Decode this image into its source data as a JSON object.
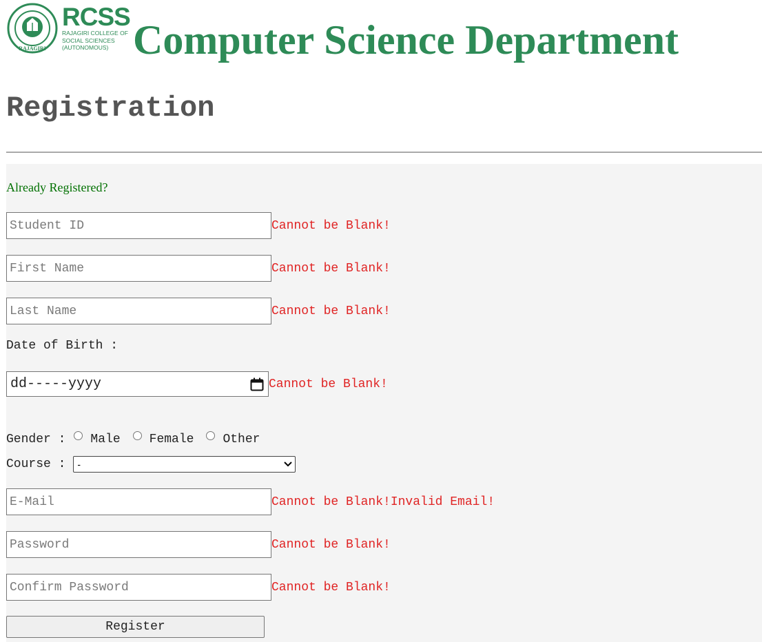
{
  "header": {
    "brand_name": "RCSS",
    "brand_sub_line1": "RAJAGIRI COLLEGE OF",
    "brand_sub_line2": "SOCIAL SCIENCES",
    "brand_sub_line3": "(AUTONOMOUS)",
    "logo_text": "RAJAGIRI",
    "title": "Computer Science Department"
  },
  "page": {
    "heading": "Registration"
  },
  "form": {
    "already_link": "Already Registered?",
    "student_id": {
      "placeholder": "Student ID",
      "error": "Cannot be Blank!"
    },
    "first_name": {
      "placeholder": "First Name",
      "error": "Cannot be Blank!"
    },
    "last_name": {
      "placeholder": "Last Name",
      "error": "Cannot be Blank!"
    },
    "dob": {
      "label": "Date of Birth :",
      "value": "dd-----yyyy",
      "error": "Cannot be Blank!"
    },
    "gender": {
      "label": "Gender :",
      "options": [
        "Male",
        "Female",
        "Other"
      ]
    },
    "course": {
      "label": "Course :",
      "selected": "-"
    },
    "email": {
      "placeholder": "E-Mail",
      "error": "Cannot be Blank!Invalid Email!"
    },
    "password": {
      "placeholder": "Password",
      "error": "Cannot be Blank!"
    },
    "confirm_password": {
      "placeholder": "Confirm Password",
      "error": "Cannot be Blank!"
    },
    "submit_label": "Register"
  },
  "colors": {
    "brand_green": "#2e8b57",
    "error_red": "#e02424",
    "link_green": "#007000",
    "panel_bg": "#f4f4f4"
  }
}
